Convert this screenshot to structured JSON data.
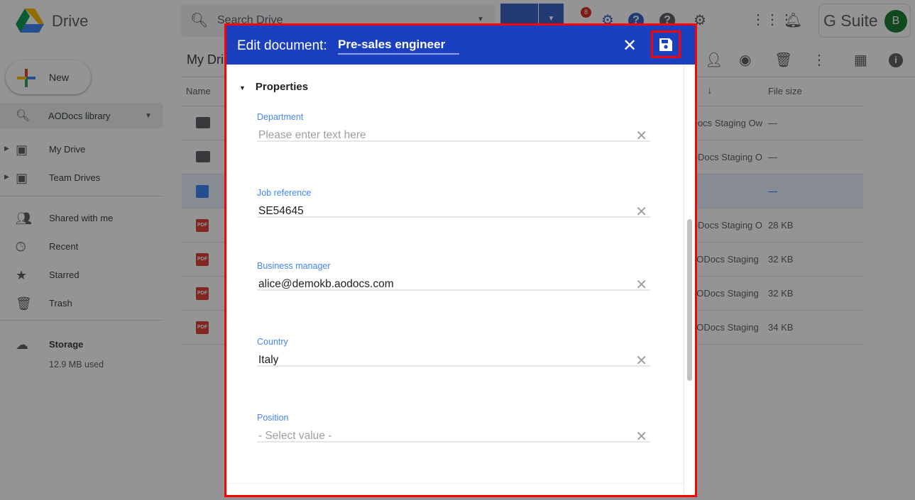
{
  "app": {
    "brand": "Drive",
    "suite": "G Suite",
    "avatar": "B",
    "badge": "8"
  },
  "search": {
    "placeholder": "Search Drive"
  },
  "sidebar": {
    "new_label": "New",
    "library": "AODocs library",
    "items": [
      {
        "label": "My Drive"
      },
      {
        "label": "Team Drives"
      },
      {
        "label": "Shared with me"
      },
      {
        "label": "Recent"
      },
      {
        "label": "Starred"
      },
      {
        "label": "Trash"
      }
    ],
    "storage": {
      "label": "Storage",
      "used": "12.9 MB used"
    }
  },
  "main": {
    "title": "My Dri",
    "columns": {
      "name": "Name",
      "size": "File size"
    },
    "rows": [
      {
        "type": "folder",
        "owner": "AODocs Staging Ow…",
        "size": "—"
      },
      {
        "type": "folder",
        "owner": "AODocs Staging O…",
        "size": "—"
      },
      {
        "type": "doc",
        "owner": "",
        "size": "—",
        "selected": true
      },
      {
        "type": "pdf",
        "owner": "AODocs Staging O…",
        "size": "28 KB"
      },
      {
        "type": "pdf",
        "owner": "AODocs Staging …",
        "size": "32 KB"
      },
      {
        "type": "pdf",
        "owner": "AODocs Staging …",
        "size": "32 KB"
      },
      {
        "type": "pdf",
        "owner": "AODocs Staging …",
        "size": "34 KB"
      }
    ]
  },
  "dialog": {
    "title": "Edit document:",
    "doc_name": "Pre-sales engineer",
    "section": "Properties",
    "fields": [
      {
        "label": "Department",
        "value": "",
        "placeholder": "Please enter text here"
      },
      {
        "label": "Job reference",
        "value": "SE54645"
      },
      {
        "label": "Business manager",
        "value": "alice@demokb.aodocs.com"
      },
      {
        "label": "Country",
        "value": "Italy"
      },
      {
        "label": "Position",
        "value": "",
        "placeholder": "- Select value -"
      }
    ]
  },
  "colors": {
    "header": "#1a3fbf",
    "highlight": "#ff0000",
    "label": "#4285f4"
  }
}
